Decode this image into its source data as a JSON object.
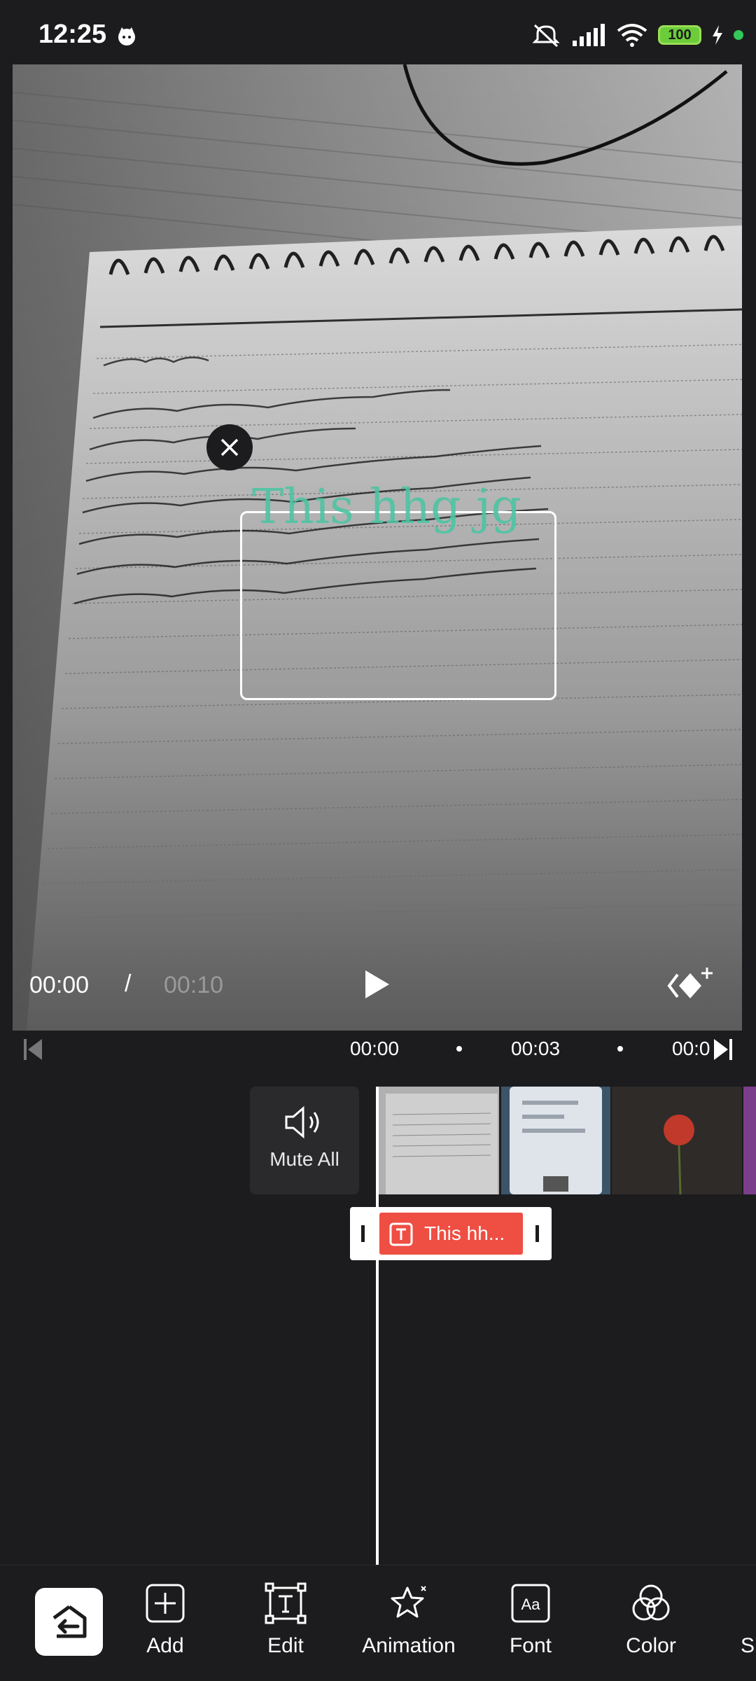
{
  "status_bar": {
    "time": "12:25",
    "battery": "100"
  },
  "preview": {
    "overlay_text": "This hhg jg",
    "current_time": "00:00",
    "separator": "/",
    "total_time": "00:10"
  },
  "ruler": {
    "ticks": [
      "00:00",
      "00:03",
      "00:0"
    ]
  },
  "tracks": {
    "mute_label": "Mute All",
    "text_clip_label": "This hh..."
  },
  "toolbar": {
    "items": [
      {
        "label": "Add",
        "icon": "add-icon"
      },
      {
        "label": "Edit",
        "icon": "edit-text-icon"
      },
      {
        "label": "Animation",
        "icon": "animation-icon"
      },
      {
        "label": "Font",
        "icon": "font-icon"
      },
      {
        "label": "Color",
        "icon": "color-icon"
      },
      {
        "label": "S",
        "icon": ""
      }
    ]
  },
  "colors": {
    "clip_red": "#ef4e43",
    "overlay_text": "#4ec4a3",
    "background": "#1c1c1e"
  }
}
